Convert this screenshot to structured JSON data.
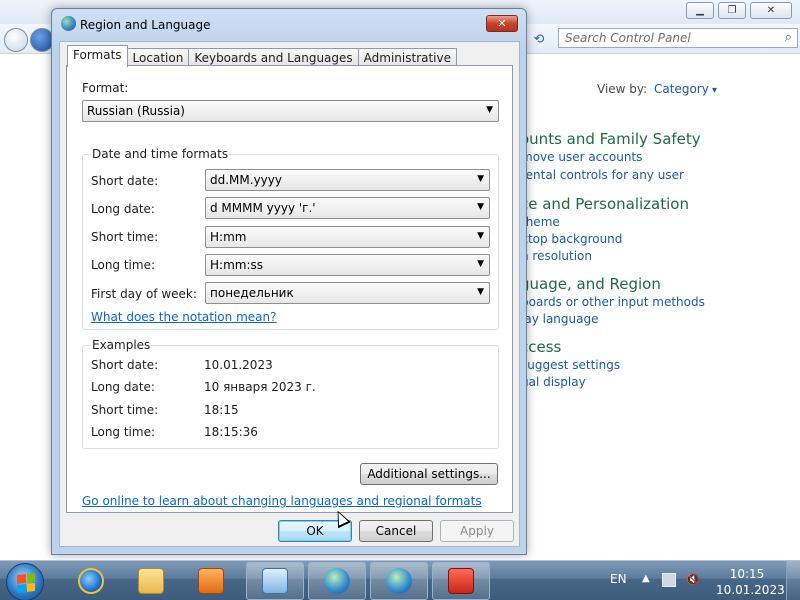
{
  "background": {
    "search_placeholder": "Search Control Panel",
    "view_by_label": "View by:",
    "view_by_value": "Category",
    "sections": [
      {
        "heading": "ounts and Family Safety",
        "links": [
          "move user accounts",
          "rental controls for any user"
        ]
      },
      {
        "heading": "ce and Personalization",
        "links": [
          "theme",
          "ktop background",
          "n resolution"
        ]
      },
      {
        "heading": "guage, and Region",
        "links": [
          "boards or other input methods",
          "lay language"
        ]
      },
      {
        "heading": "ccess",
        "links": [
          "suggest settings",
          "ual display"
        ]
      }
    ]
  },
  "dialog": {
    "title": "Region and Language",
    "close_glyph": "✕",
    "tabs": [
      "Formats",
      "Location",
      "Keyboards and Languages",
      "Administrative"
    ],
    "active_tab": "Formats",
    "format_label": "Format:",
    "format_value": "Russian (Russia)",
    "datetime_group_title": "Date and time formats",
    "fields": [
      {
        "label": "Short date:",
        "value": "dd.MM.yyyy"
      },
      {
        "label": "Long date:",
        "value": "d MMMM yyyy 'г.'"
      },
      {
        "label": "Short time:",
        "value": "H:mm"
      },
      {
        "label": "Long time:",
        "value": "H:mm:ss"
      },
      {
        "label": "First day of week:",
        "value": "понедельник"
      }
    ],
    "notation_link": "What does the notation mean?",
    "examples_group_title": "Examples",
    "examples": [
      {
        "label": "Short date:",
        "value": "10.01.2023"
      },
      {
        "label": "Long date:",
        "value": "10 января 2023 г."
      },
      {
        "label": "Short time:",
        "value": "18:15"
      },
      {
        "label": "Long time:",
        "value": "18:15:36"
      }
    ],
    "additional_settings_label": "Additional settings...",
    "online_link": "Go online to learn about changing languages and regional formats",
    "ok_label": "OK",
    "cancel_label": "Cancel",
    "apply_label": "Apply"
  },
  "taskbar": {
    "language": "EN",
    "time": "10:15",
    "date": "10.01.2023"
  }
}
